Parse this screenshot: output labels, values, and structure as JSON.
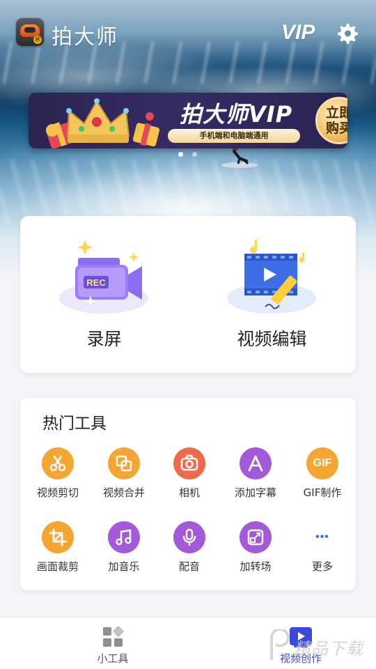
{
  "header": {
    "app_title": "拍大师",
    "vip_label": "VIP",
    "logo_badge": "Ⓜ"
  },
  "banner": {
    "title": "拍大师VIP",
    "subtitle": "手机端和电脑端通用",
    "buy_label": "立即购买",
    "carousel_total": 2,
    "carousel_active": 1
  },
  "main_features": [
    {
      "label": "录屏",
      "icon": "rec-camera-icon"
    },
    {
      "label": "视频编辑",
      "icon": "video-edit-icon"
    }
  ],
  "hot_tools": {
    "title": "热门工具",
    "items": [
      {
        "label": "视频剪切",
        "icon": "scissors-icon",
        "color": "#f5a531"
      },
      {
        "label": "视频合并",
        "icon": "merge-icon",
        "color": "#f5a531"
      },
      {
        "label": "相机",
        "icon": "camera-icon",
        "color": "#f06a4a"
      },
      {
        "label": "添加字幕",
        "icon": "subtitle-icon",
        "color": "#a25ad8"
      },
      {
        "label": "GIF制作",
        "icon": "gif-icon",
        "color": "#f5a531",
        "icon_text": "GIF"
      },
      {
        "label": "画面裁剪",
        "icon": "crop-icon",
        "color": "#f5a531"
      },
      {
        "label": "加音乐",
        "icon": "music-icon",
        "color": "#a25ad8"
      },
      {
        "label": "配音",
        "icon": "microphone-icon",
        "color": "#a25ad8"
      },
      {
        "label": "加转场",
        "icon": "transition-icon",
        "color": "#a25ad8"
      },
      {
        "label": "更多",
        "icon": "more-icon",
        "color": "#4a6ad8",
        "icon_text": "•••"
      }
    ]
  },
  "bottom_nav": {
    "items": [
      {
        "label": "小工具",
        "icon": "tools-grid-icon",
        "active": false
      },
      {
        "label": "视频创作",
        "icon": "video-play-icon",
        "active": true
      }
    ]
  },
  "watermark": {
    "text": "精品下载"
  },
  "colors": {
    "accent_blue": "#3b4ad6",
    "vip_gold": "#f1c46a",
    "banner_bg": "#2b2452"
  }
}
